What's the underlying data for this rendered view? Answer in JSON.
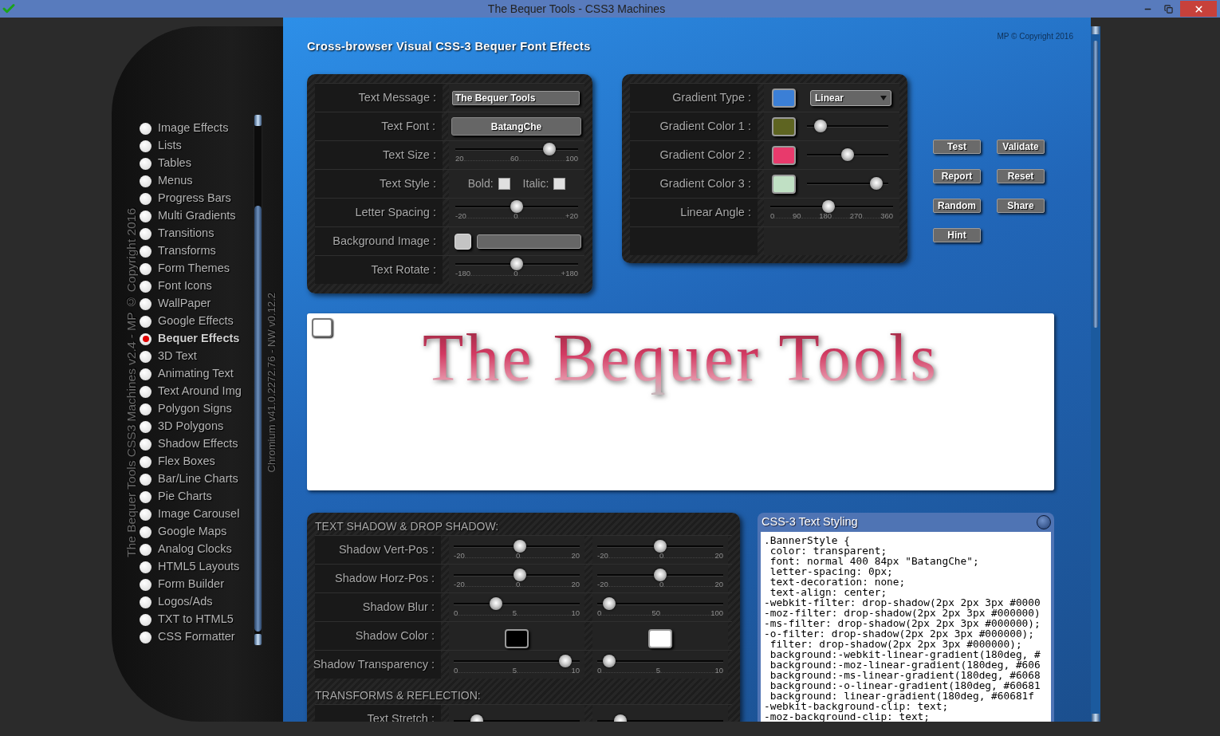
{
  "window": {
    "title": "The Bequer Tools - CSS3 Machines"
  },
  "sidebar": {
    "caption": "The Bequer Tools CSS3 Machines v2.4 - MP © Copyright 2016",
    "version": "Chromium v41.0.2272.76 - NW v0.12.2",
    "items": [
      {
        "label": "Image Effects",
        "selected": false
      },
      {
        "label": "Lists",
        "selected": false
      },
      {
        "label": "Tables",
        "selected": false
      },
      {
        "label": "Menus",
        "selected": false
      },
      {
        "label": "Progress Bars",
        "selected": false
      },
      {
        "label": "Multi Gradients",
        "selected": false
      },
      {
        "label": "Transitions",
        "selected": false
      },
      {
        "label": "Transforms",
        "selected": false
      },
      {
        "label": "Form Themes",
        "selected": false
      },
      {
        "label": "Font Icons",
        "selected": false
      },
      {
        "label": "WallPaper",
        "selected": false
      },
      {
        "label": "Google Effects",
        "selected": false
      },
      {
        "label": "Bequer Effects",
        "selected": true
      },
      {
        "label": "3D Text",
        "selected": false
      },
      {
        "label": "Animating Text",
        "selected": false
      },
      {
        "label": "Text Around Img",
        "selected": false
      },
      {
        "label": "Polygon Signs",
        "selected": false
      },
      {
        "label": "3D Polygons",
        "selected": false
      },
      {
        "label": "Shadow Effects",
        "selected": false
      },
      {
        "label": "Flex Boxes",
        "selected": false
      },
      {
        "label": "Bar/Line Charts",
        "selected": false
      },
      {
        "label": "Pie Charts",
        "selected": false
      },
      {
        "label": "Image Carousel",
        "selected": false
      },
      {
        "label": "Google Maps",
        "selected": false
      },
      {
        "label": "Analog Clocks",
        "selected": false
      },
      {
        "label": "HTML5 Layouts",
        "selected": false
      },
      {
        "label": "Form Builder",
        "selected": false
      },
      {
        "label": "Logos/Ads",
        "selected": false
      },
      {
        "label": "TXT to HTML5",
        "selected": false
      },
      {
        "label": "CSS Formatter",
        "selected": false
      }
    ]
  },
  "header": {
    "title": "Cross-browser Visual CSS-3 Bequer Font Effects",
    "copyright": "MP © Copyright 2016"
  },
  "font_panel": {
    "rows": [
      {
        "label": "Text Message :",
        "kind": "text_input",
        "value": "The Bequer Tools"
      },
      {
        "label": "Text Font :",
        "kind": "button",
        "value": "BatangChe"
      },
      {
        "label": "Text Size :",
        "kind": "slider",
        "level": 0.8,
        "ticks": [
          "20",
          "60",
          "100"
        ]
      },
      {
        "label": "Text Style :",
        "kind": "checkboxes",
        "options": [
          {
            "label": "Bold:",
            "checked": false
          },
          {
            "label": "Italic:",
            "checked": false
          }
        ]
      },
      {
        "label": "Letter Spacing :",
        "kind": "slider",
        "level": 0.5,
        "ticks": [
          "-20",
          "0",
          "+20"
        ]
      },
      {
        "label": "Background Image :",
        "kind": "image_picker"
      },
      {
        "label": "Text Rotate :",
        "kind": "slider",
        "level": 0.5,
        "ticks": [
          "-180",
          "0",
          "+180"
        ]
      }
    ]
  },
  "gradient_panel": {
    "rows": [
      {
        "label": "Gradient Type :",
        "kind": "select",
        "color": "#3b7fd6",
        "value": "Linear"
      },
      {
        "label": "Gradient Color 1 :",
        "kind": "color_slider",
        "color": "#5e6421",
        "level": 0.1
      },
      {
        "label": "Gradient Color 2 :",
        "kind": "color_slider",
        "color": "#e83a6c",
        "level": 0.5
      },
      {
        "label": "Gradient Color 3 :",
        "kind": "color_slider",
        "color": "#c0e0c4",
        "level": 0.92
      },
      {
        "label": "Linear Angle :",
        "kind": "slider",
        "level": 0.47,
        "ticks": [
          "0",
          "90",
          "180",
          "270",
          "360"
        ]
      },
      {
        "kind": "blank"
      }
    ]
  },
  "actions": [
    "Test",
    "Validate",
    "Report",
    "Reset",
    "Random",
    "Share",
    "Hint"
  ],
  "preview": {
    "checked": false,
    "text": "The Bequer Tools"
  },
  "shadow_panel": {
    "sections": [
      {
        "heading": "TEXT SHADOW & DROP SHADOW:",
        "rows": [
          {
            "label": "Shadow Vert-Pos :",
            "cells": [
              {
                "kind": "slider",
                "level": 0.53,
                "ticks": [
                  "-20",
                  "0",
                  "20"
                ]
              },
              {
                "kind": "slider",
                "level": 0.5,
                "ticks": [
                  "-20",
                  "0",
                  "20"
                ]
              }
            ]
          },
          {
            "label": "Shadow Horz-Pos :",
            "cells": [
              {
                "kind": "slider",
                "level": 0.53,
                "ticks": [
                  "-20",
                  "0",
                  "20"
                ]
              },
              {
                "kind": "slider",
                "level": 0.5,
                "ticks": [
                  "-20",
                  "0",
                  "20"
                ]
              }
            ]
          },
          {
            "label": "Shadow Blur :",
            "cells": [
              {
                "kind": "slider",
                "level": 0.32,
                "ticks": [
                  "0",
                  "5",
                  "10"
                ]
              },
              {
                "kind": "slider",
                "level": 0.05,
                "ticks": [
                  "0",
                  "50",
                  "100"
                ]
              }
            ]
          },
          {
            "label": "Shadow Color :",
            "cells": [
              {
                "kind": "swatch",
                "color": "#000000"
              },
              {
                "kind": "swatch",
                "color": "#ffffff"
              }
            ]
          },
          {
            "label": "Shadow Transparency :",
            "cells": [
              {
                "kind": "slider",
                "level": 0.93,
                "ticks": [
                  "0",
                  "5",
                  "10"
                ]
              },
              {
                "kind": "slider",
                "level": 0.05,
                "ticks": [
                  "0",
                  "5",
                  "10"
                ]
              }
            ]
          }
        ]
      },
      {
        "heading": "TRANSFORMS & REFLECTION:",
        "rows": [
          {
            "label": "Text Stretch :",
            "cells": [
              {
                "kind": "slider",
                "level": 0.15
              },
              {
                "kind": "slider",
                "level": 0.15
              }
            ]
          }
        ]
      }
    ]
  },
  "code_panel": {
    "title": "CSS-3 Text Styling",
    "lines": [
      ".BannerStyle {",
      " color: transparent;",
      " font: normal 400 84px \"BatangChe\";",
      " letter-spacing: 0px;",
      " text-decoration: none;",
      " text-align: center;",
      "-webkit-filter: drop-shadow(2px 2px 3px #0000",
      "-moz-filter: drop-shadow(2px 2px 3px #000000)",
      "-ms-filter: drop-shadow(2px 2px 3px #000000);",
      "-o-filter: drop-shadow(2px 2px 3px #000000);",
      " filter: drop-shadow(2px 2px 3px #000000);",
      " background:-webkit-linear-gradient(180deg, #",
      " background:-moz-linear-gradient(180deg, #606",
      " background:-ms-linear-gradient(180deg, #6068",
      " background:-o-linear-gradient(180deg, #60681",
      " background: linear-gradient(180deg, #60681f",
      "-webkit-background-clip: text;",
      "-moz-background-clip: text;"
    ]
  }
}
